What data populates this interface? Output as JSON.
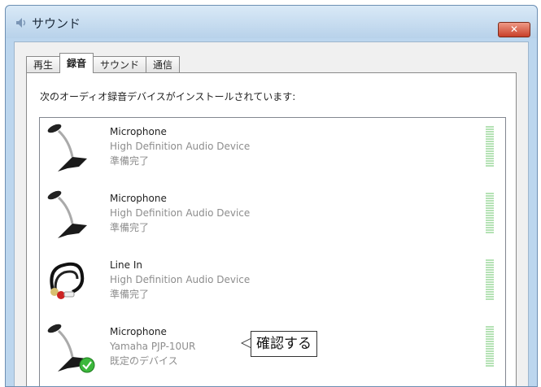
{
  "window": {
    "title": "サウンド",
    "close_label": "✕"
  },
  "tabs": [
    {
      "label": "再生",
      "active": false
    },
    {
      "label": "録音",
      "active": true
    },
    {
      "label": "サウンド",
      "active": false
    },
    {
      "label": "通信",
      "active": false
    }
  ],
  "instruction": "次のオーディオ録音デバイスがインストールされています:",
  "devices": [
    {
      "name": "Microphone",
      "description": "High Definition Audio Device",
      "status": "準備完了",
      "icon": "microphone-icon"
    },
    {
      "name": "Microphone",
      "description": "High Definition Audio Device",
      "status": "準備完了",
      "icon": "microphone-icon"
    },
    {
      "name": "Line In",
      "description": "High Definition Audio Device",
      "status": "準備完了",
      "icon": "line-in-cable-icon"
    },
    {
      "name": "Microphone",
      "description": "Yamaha PJP-10UR",
      "status": "既定のデバイス",
      "icon": "microphone-default-icon"
    }
  ],
  "callout": {
    "text": "確認する"
  },
  "colors": {
    "meter": "#b5e2b5",
    "default_check": "#3cb83c",
    "close_button": "#c8402a"
  }
}
